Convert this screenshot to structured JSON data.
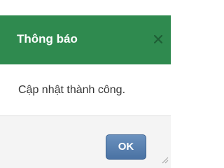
{
  "dialog": {
    "title": "Thông báo",
    "message": "Cập nhật thành công.",
    "ok_label": "OK",
    "close_icon": "close-icon",
    "resize_icon": "resize-grip-icon"
  },
  "colors": {
    "header_bg": "#2f8a4f",
    "title_text": "#ffffff",
    "close_icon": "#1e5e35",
    "message_text": "#333333",
    "footer_bg": "#f4f4f4",
    "button_bg": "#5a82b2",
    "button_text": "#ffffff"
  }
}
